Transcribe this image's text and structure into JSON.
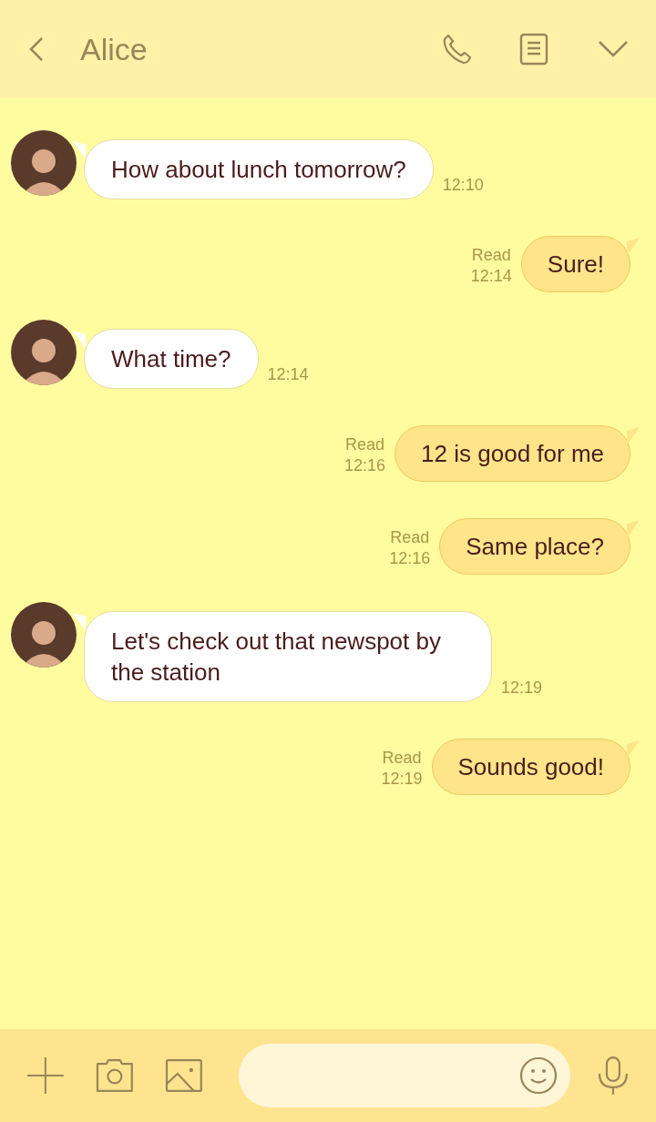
{
  "header": {
    "title": "Alice"
  },
  "messages": [
    {
      "kind": "received",
      "text": "How about lunch tomorrow?",
      "time": "12:10"
    },
    {
      "kind": "sent",
      "text": "Sure!",
      "status": "Read",
      "time": "12:14"
    },
    {
      "kind": "received",
      "text": "What time?",
      "time": "12:14"
    },
    {
      "kind": "sent",
      "text": "12 is good for me",
      "status": "Read",
      "time": "12:16"
    },
    {
      "kind": "sent",
      "text": "Same place?",
      "status": "Read",
      "time": "12:16"
    },
    {
      "kind": "received",
      "text": "Let's check out that newspot by the station",
      "time": "12:19"
    },
    {
      "kind": "sent",
      "text": "Sounds good!",
      "status": "Read",
      "time": "12:19"
    }
  ]
}
